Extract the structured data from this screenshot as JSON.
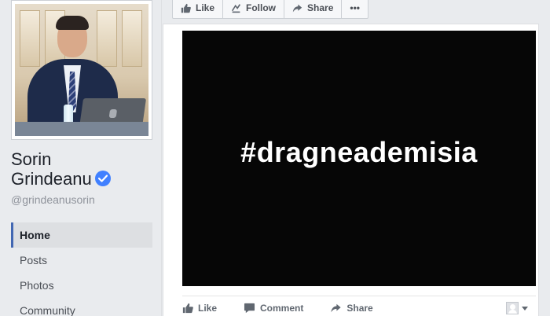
{
  "profile": {
    "name_line1": "Sorin",
    "name_line2": "Grindeanu",
    "handle": "@grindeanusorin",
    "verified": true
  },
  "nav": {
    "items": [
      {
        "label": "Home",
        "active": true
      },
      {
        "label": "Posts",
        "active": false
      },
      {
        "label": "Photos",
        "active": false
      },
      {
        "label": "Community",
        "active": false
      }
    ]
  },
  "top_actions": {
    "like": "Like",
    "follow": "Follow",
    "share": "Share",
    "more": "•••"
  },
  "post": {
    "image_text": "#dragneademisia",
    "actions": {
      "like": "Like",
      "comment": "Comment",
      "share": "Share"
    }
  },
  "colors": {
    "accent": "#4267b2",
    "verified": "#4080ff",
    "background": "#e9ebee"
  }
}
